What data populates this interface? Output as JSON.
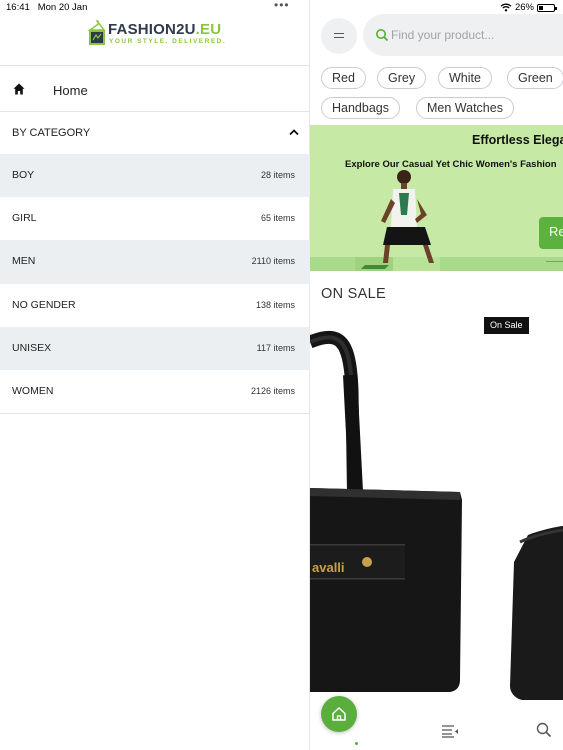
{
  "status_bar": {
    "time": "16:41",
    "date": "Mon 20 Jan",
    "battery": "26%",
    "battery_level": 0.26
  },
  "drawer": {
    "logo": {
      "name_main": "FASHION2U",
      "name_suffix": ".EU",
      "tagline": "YOUR STYLE. DELIVERED.",
      "icon": "hanger-bag-logo"
    },
    "home": {
      "label": "Home",
      "icon": "home-icon"
    },
    "category_header": {
      "label": "BY CATEGORY",
      "icon": "chevron-up-icon"
    },
    "categories": [
      {
        "name": "BOY",
        "count": "28 items"
      },
      {
        "name": "GIRL",
        "count": "65 items"
      },
      {
        "name": "MEN",
        "count": "2110 items"
      },
      {
        "name": "NO GENDER",
        "count": "138 items"
      },
      {
        "name": "UNISEX",
        "count": "117 items"
      },
      {
        "name": "WOMEN",
        "count": "2126 items"
      }
    ]
  },
  "content": {
    "search": {
      "placeholder": "Find your product..."
    },
    "chips": [
      "Red",
      "Grey",
      "White",
      "Green",
      "Handbags",
      "Men Watches"
    ],
    "banner": {
      "headline": "Effortless Elega",
      "subtitle": "Explore Our Casual Yet Chic Women's Fashion",
      "cta": "Re"
    },
    "section_title": "ON SALE",
    "sale_badge": "On Sale",
    "product_brand_text": "avalli"
  },
  "colors": {
    "accent": "#5aae3c",
    "banner_bg": "#c7e9a6",
    "row_shade": "#eceff1",
    "logo_dark": "#2f3a4a"
  }
}
